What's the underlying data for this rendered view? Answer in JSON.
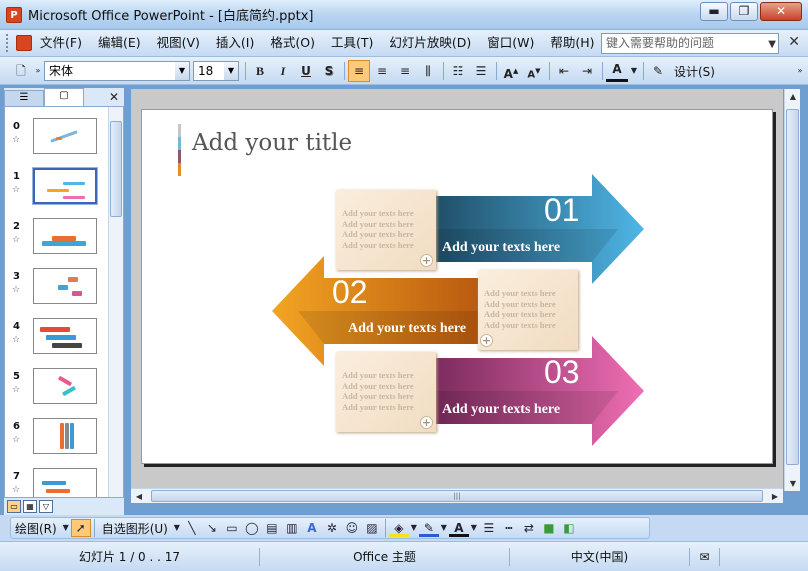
{
  "window": {
    "title": "Microsoft Office PowerPoint - [白底简约.pptx]",
    "minimize": "▬",
    "restore": "❐",
    "close": "✕",
    "app_icon_letter": "P"
  },
  "menu": {
    "items": [
      "文件(F)",
      "编辑(E)",
      "视图(V)",
      "插入(I)",
      "格式(O)",
      "工具(T)",
      "幻灯片放映(D)",
      "窗口(W)",
      "帮助(H)"
    ],
    "help_placeholder": "键入需要帮助的问题",
    "close": "✕"
  },
  "format_toolbar": {
    "font": "宋体",
    "size": "18",
    "bold": "B",
    "italic": "I",
    "underline": "U",
    "shadow": "S",
    "design_label": "设计(S)"
  },
  "outline_pane": {
    "close": "✕",
    "slides": [
      {
        "num": "0",
        "star": "☆"
      },
      {
        "num": "1",
        "star": "☆"
      },
      {
        "num": "2",
        "star": "☆"
      },
      {
        "num": "3",
        "star": "☆"
      },
      {
        "num": "4",
        "star": "☆"
      },
      {
        "num": "5",
        "star": "☆"
      },
      {
        "num": "6",
        "star": "☆"
      },
      {
        "num": "7",
        "star": "☆"
      }
    ]
  },
  "slide": {
    "title": "Add your title",
    "arrows": [
      {
        "num": "01",
        "text": "Add your texts here",
        "color_dark": "#1f4d66",
        "color_light": "#4fb6e6"
      },
      {
        "num": "02",
        "text": "Add your texts here",
        "color_dark": "#b8580f",
        "color_light": "#f3a523"
      },
      {
        "num": "03",
        "text": "Add your texts here",
        "color_dark": "#7a2a5d",
        "color_light": "#ef6eb3"
      }
    ],
    "note_lines": [
      "Add your texts here",
      "Add your texts here",
      "Add your texts here",
      "Add your texts here"
    ],
    "plus": "+"
  },
  "draw_toolbar": {
    "draw_label": "绘图(R)",
    "autoshape_label": "自选图形(U)"
  },
  "status": {
    "slide_info": "幻灯片 1 / 0 . . 17",
    "theme": "Office 主题",
    "language": "中文(中国)"
  }
}
